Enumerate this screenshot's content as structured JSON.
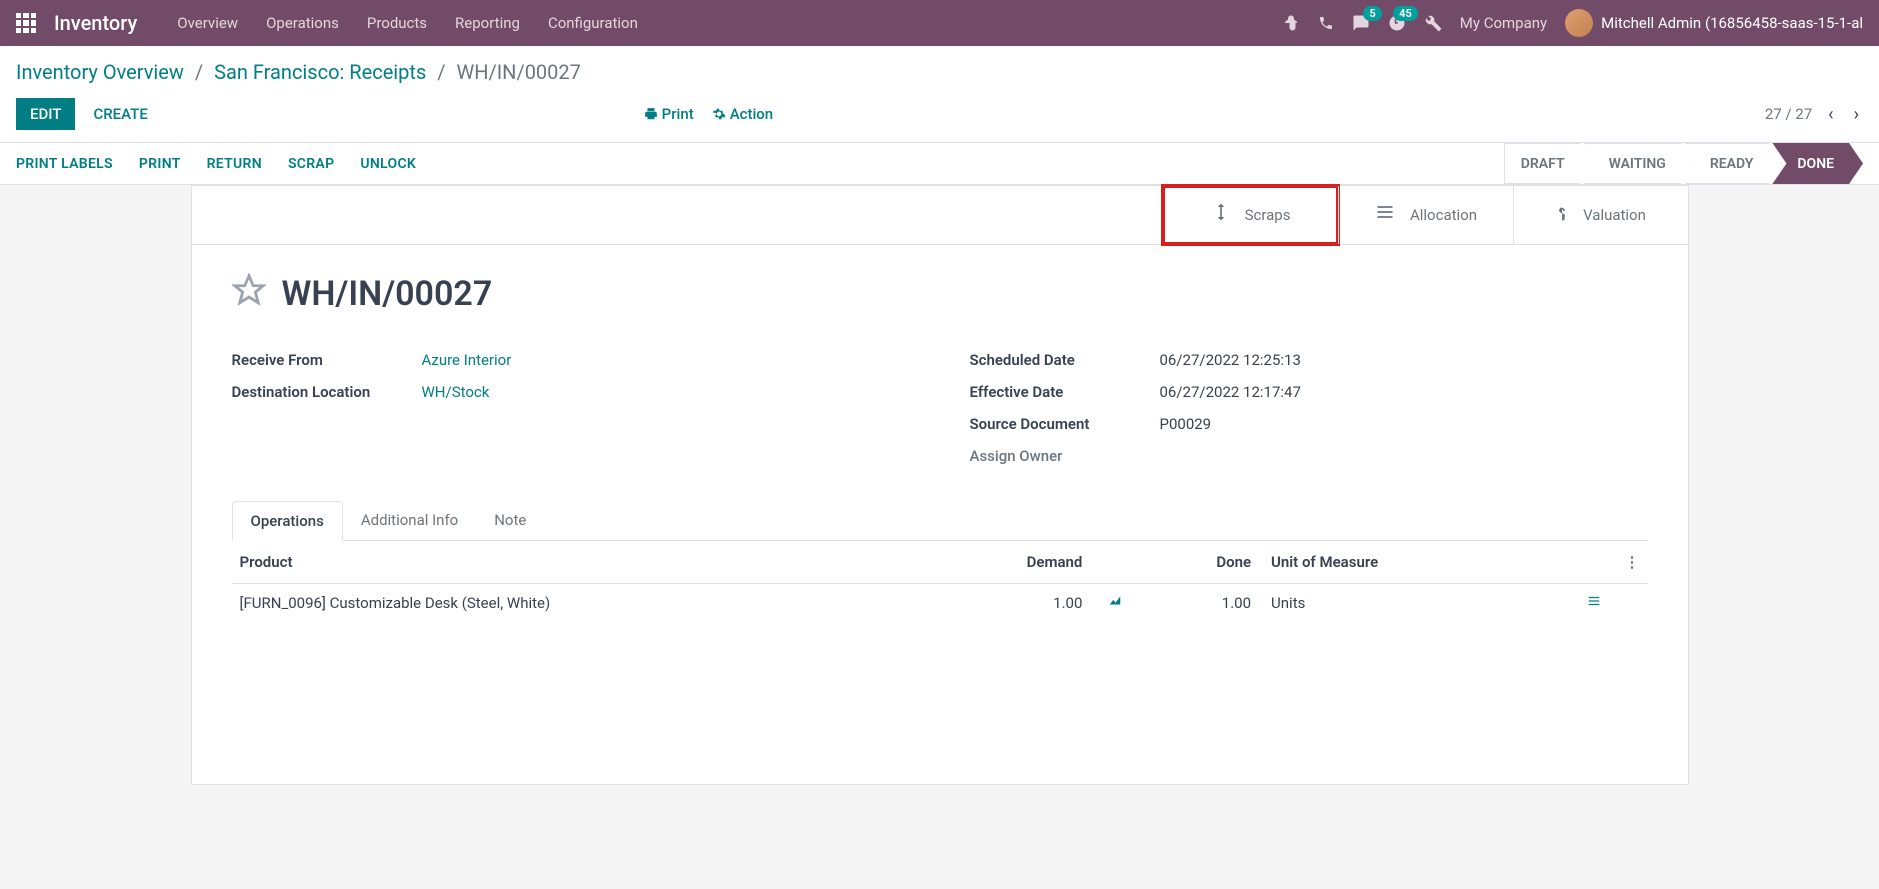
{
  "app": {
    "name": "Inventory"
  },
  "top_menu": [
    "Overview",
    "Operations",
    "Products",
    "Reporting",
    "Configuration"
  ],
  "systray": {
    "messages_badge": "5",
    "activities_badge": "45",
    "company": "My Company",
    "user": "Mitchell Admin (16856458-saas-15-1-al"
  },
  "breadcrumb": {
    "l1": "Inventory Overview",
    "l2": "San Francisco: Receipts",
    "current": "WH/IN/00027"
  },
  "buttons": {
    "edit": "EDIT",
    "create": "CREATE",
    "print": "Print",
    "action": "Action"
  },
  "pager": {
    "text": "27 / 27"
  },
  "toolbar": [
    "PRINT LABELS",
    "PRINT",
    "RETURN",
    "SCRAP",
    "UNLOCK"
  ],
  "status": [
    "DRAFT",
    "WAITING",
    "READY",
    "DONE"
  ],
  "stat_buttons": {
    "scraps": "Scraps",
    "allocation": "Allocation",
    "valuation": "Valuation"
  },
  "record": {
    "name": "WH/IN/00027",
    "fields_left": {
      "receive_from": {
        "label": "Receive From",
        "value": "Azure Interior"
      },
      "dest": {
        "label": "Destination Location",
        "value": "WH/Stock"
      }
    },
    "fields_right": {
      "scheduled": {
        "label": "Scheduled Date",
        "value": "06/27/2022 12:25:13"
      },
      "effective": {
        "label": "Effective Date",
        "value": "06/27/2022 12:17:47"
      },
      "source": {
        "label": "Source Document",
        "value": "P00029"
      },
      "owner": {
        "label": "Assign Owner",
        "value": ""
      }
    }
  },
  "tabs": [
    "Operations",
    "Additional Info",
    "Note"
  ],
  "table": {
    "headers": {
      "product": "Product",
      "demand": "Demand",
      "done": "Done",
      "uom": "Unit of Measure"
    },
    "rows": [
      {
        "product": "[FURN_0096] Customizable Desk (Steel, White)",
        "demand": "1.00",
        "done": "1.00",
        "uom": "Units"
      }
    ]
  }
}
